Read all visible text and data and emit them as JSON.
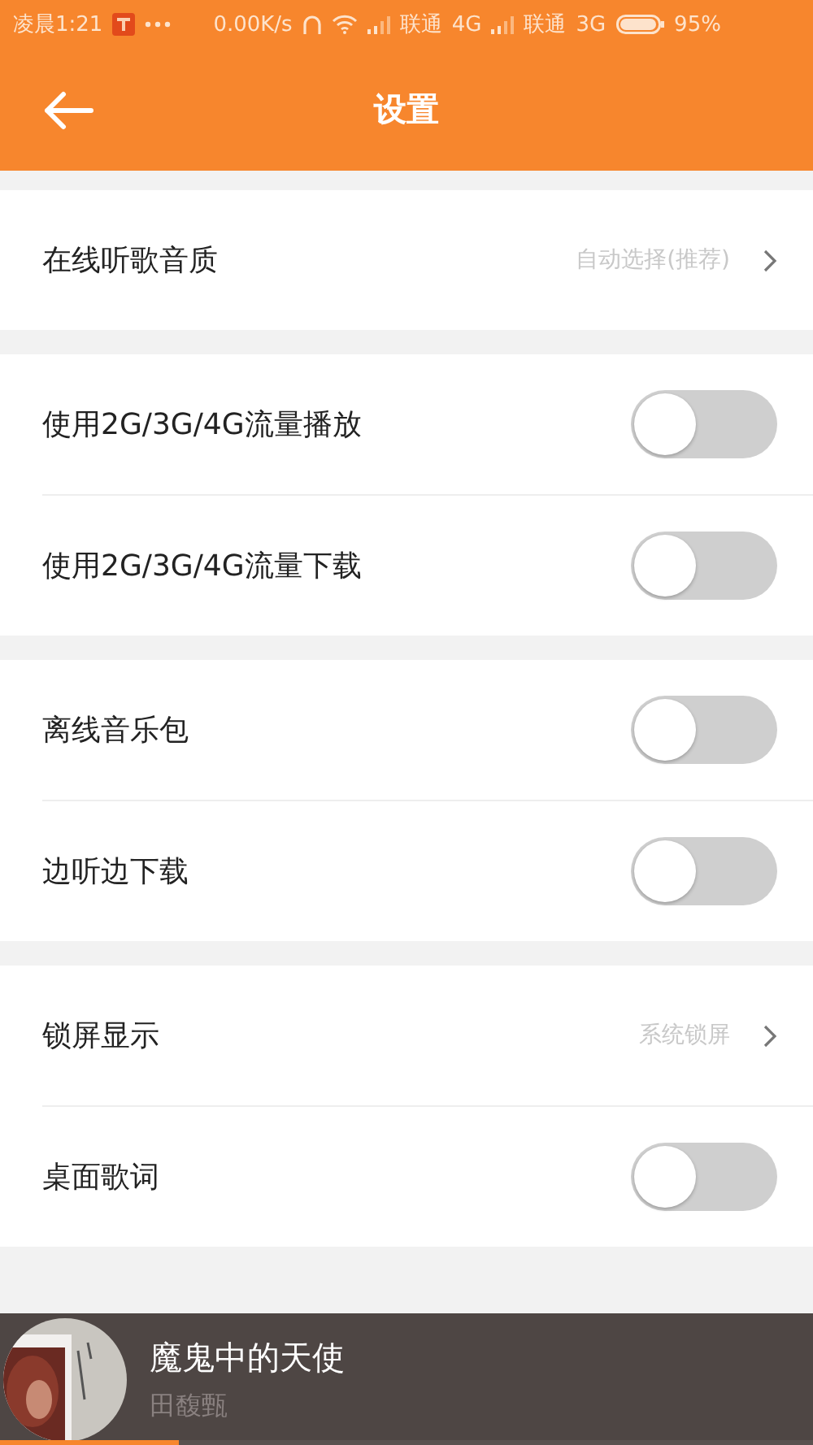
{
  "status_bar": {
    "time": "凌晨1:21",
    "speed": "0.00K/s",
    "carrier_1": "联通",
    "network_1": "4G",
    "carrier_2": "联通",
    "network_2": "3G",
    "battery": "95%"
  },
  "header": {
    "title": "设置"
  },
  "sections": [
    {
      "rows": [
        {
          "kind": "value",
          "label": "在线听歌音质",
          "value": "自动选择(推荐)"
        }
      ]
    },
    {
      "rows": [
        {
          "kind": "toggle",
          "label": "使用2G/3G/4G流量播放",
          "on": false
        },
        {
          "kind": "toggle",
          "label": "使用2G/3G/4G流量下载",
          "on": false
        }
      ]
    },
    {
      "rows": [
        {
          "kind": "toggle",
          "label": "离线音乐包",
          "on": false
        },
        {
          "kind": "toggle",
          "label": "边听边下载",
          "on": false
        }
      ]
    },
    {
      "rows": [
        {
          "kind": "value",
          "label": "锁屏显示",
          "value": "系统锁屏"
        },
        {
          "kind": "toggle",
          "label": "桌面歌词",
          "on": false
        }
      ]
    }
  ],
  "player": {
    "title": "魔鬼中的天使",
    "artist": "田馥甄",
    "level": 0.22
  }
}
